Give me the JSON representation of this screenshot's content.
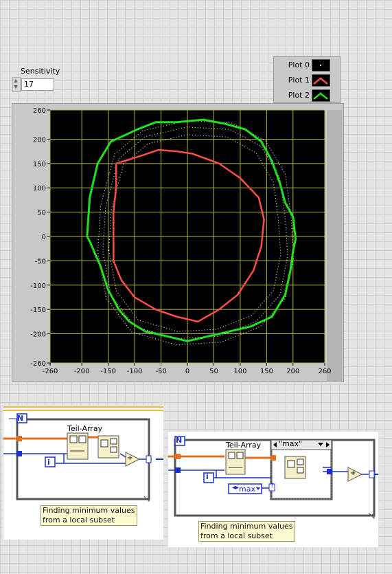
{
  "sensitivity": {
    "label": "Sensitivity",
    "value": "17"
  },
  "legend": {
    "items": [
      {
        "name": "Plot 0",
        "color": "#ffffff"
      },
      {
        "name": "Plot 1",
        "color": "#ff4d4d"
      },
      {
        "name": "Plot 2",
        "color": "#20e020"
      }
    ]
  },
  "chart_data": {
    "type": "scatter",
    "title": "",
    "xlabel": "",
    "ylabel": "",
    "xlim": [
      -260,
      260
    ],
    "ylim": [
      -260,
      260
    ],
    "x_ticks": [
      -260,
      -200,
      -150,
      -100,
      -50,
      0,
      50,
      100,
      150,
      200,
      260
    ],
    "y_ticks": [
      260,
      200,
      150,
      100,
      50,
      0,
      -50,
      -100,
      -150,
      -200,
      -260
    ],
    "grid": true,
    "background": "#000000",
    "grid_color": "#b5b542",
    "series": [
      {
        "name": "Plot 0",
        "color": "#ffffff",
        "style": "dotted",
        "points": [
          [
            -130,
            160
          ],
          [
            -80,
            205
          ],
          [
            0,
            225
          ],
          [
            80,
            220
          ],
          [
            140,
            185
          ],
          [
            175,
            120
          ],
          [
            185,
            40
          ],
          [
            190,
            -40
          ],
          [
            175,
            -120
          ],
          [
            130,
            -175
          ],
          [
            60,
            -205
          ],
          [
            -20,
            -210
          ],
          [
            -100,
            -185
          ],
          [
            -145,
            -120
          ],
          [
            -160,
            -30
          ],
          [
            -155,
            60
          ],
          [
            -130,
            160
          ]
        ]
      },
      {
        "name": "Plot 1",
        "color": "#ff4d4d",
        "points": [
          [
            -135,
            150
          ],
          [
            -120,
            155
          ],
          [
            -90,
            165
          ],
          [
            -55,
            178
          ],
          [
            -20,
            175
          ],
          [
            10,
            170
          ],
          [
            60,
            150
          ],
          [
            100,
            120
          ],
          [
            135,
            80
          ],
          [
            145,
            35
          ],
          [
            140,
            -20
          ],
          [
            125,
            -70
          ],
          [
            95,
            -120
          ],
          [
            60,
            -150
          ],
          [
            20,
            -175
          ],
          [
            -20,
            -165
          ],
          [
            -60,
            -150
          ],
          [
            -100,
            -125
          ],
          [
            -125,
            -90
          ],
          [
            -140,
            -50
          ],
          [
            -140,
            0
          ],
          [
            -140,
            50
          ],
          [
            -135,
            100
          ],
          [
            -135,
            150
          ]
        ]
      },
      {
        "name": "Plot 2",
        "color": "#20e020",
        "points": [
          [
            -190,
            0
          ],
          [
            -185,
            80
          ],
          [
            -170,
            150
          ],
          [
            -145,
            195
          ],
          [
            -95,
            220
          ],
          [
            -60,
            235
          ],
          [
            -20,
            235
          ],
          [
            30,
            240
          ],
          [
            70,
            232
          ],
          [
            110,
            220
          ],
          [
            140,
            195
          ],
          [
            160,
            155
          ],
          [
            175,
            110
          ],
          [
            185,
            70
          ],
          [
            200,
            40
          ],
          [
            205,
            -5
          ],
          [
            200,
            -30
          ],
          [
            195,
            -70
          ],
          [
            185,
            -120
          ],
          [
            160,
            -165
          ],
          [
            120,
            -185
          ],
          [
            60,
            -200
          ],
          [
            0,
            -215
          ],
          [
            -40,
            -205
          ],
          [
            -80,
            -195
          ],
          [
            -110,
            -175
          ],
          [
            -130,
            -150
          ],
          [
            -150,
            -110
          ],
          [
            -165,
            -60
          ],
          [
            -185,
            -10
          ],
          [
            -190,
            0
          ]
        ]
      }
    ]
  },
  "diagram1": {
    "constant_N": "N",
    "function_name": "Teil-Array",
    "iterator_i": "i",
    "add_op": "+",
    "comment": [
      "Finding minimum values",
      "from a local subset"
    ]
  },
  "diagram2": {
    "constant_N": "N",
    "function_name": "Teil-Array",
    "iterator_i": "i",
    "case_selector": "\"max\"",
    "enum_value": "max",
    "add_op": "+",
    "case_term": "?",
    "comment": [
      "Finding minimum values",
      "from a local subset"
    ]
  }
}
